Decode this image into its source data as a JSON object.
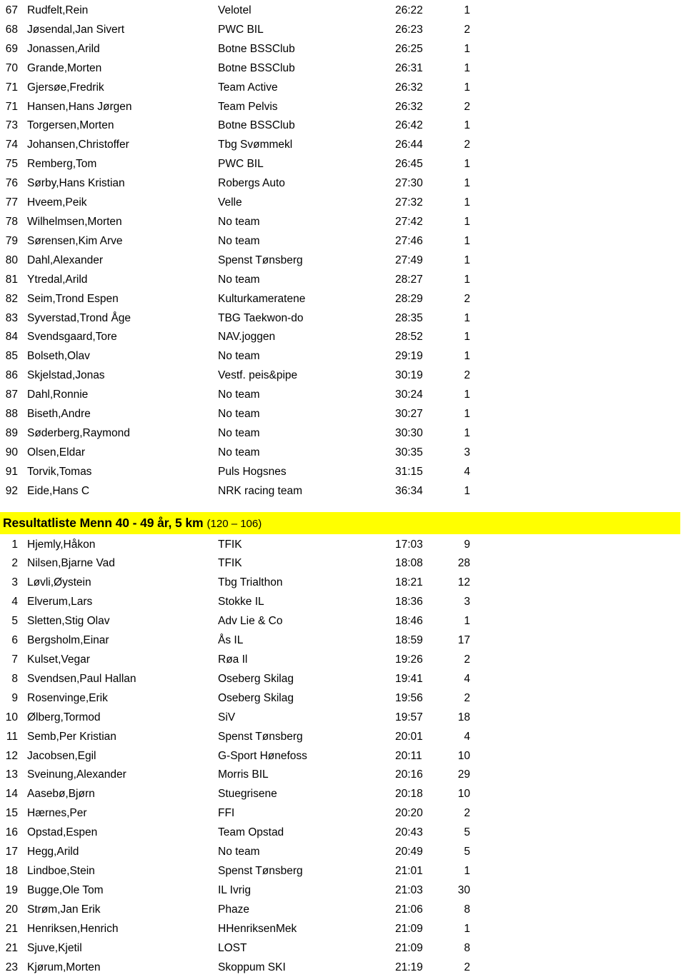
{
  "document": {
    "kind": "race-results-listing",
    "highlight_color": "#ffff00",
    "text_color": "#000000",
    "background_color": "#ffffff"
  },
  "columns": [
    "rank",
    "name",
    "team",
    "time",
    "points"
  ],
  "sections": [
    {
      "heading": null,
      "continued": true,
      "rows": [
        {
          "rank": "67",
          "name": "Rudfelt,Rein",
          "team": "Velotel",
          "time": "26:22",
          "points": "1"
        },
        {
          "rank": "68",
          "name": "Jøsendal,Jan Sivert",
          "team": "PWC BIL",
          "time": "26:23",
          "points": "2"
        },
        {
          "rank": "69",
          "name": "Jonassen,Arild",
          "team": "Botne BSSClub",
          "time": "26:25",
          "points": "1"
        },
        {
          "rank": "70",
          "name": "Grande,Morten",
          "team": "Botne BSSClub",
          "time": "26:31",
          "points": "1"
        },
        {
          "rank": "71",
          "name": "Gjersøe,Fredrik",
          "team": "Team Active",
          "time": "26:32",
          "points": "1"
        },
        {
          "rank": "71",
          "name": "Hansen,Hans Jørgen",
          "team": "Team Pelvis",
          "time": "26:32",
          "points": "2"
        },
        {
          "rank": "73",
          "name": "Torgersen,Morten",
          "team": "Botne BSSClub",
          "time": "26:42",
          "points": "1"
        },
        {
          "rank": "74",
          "name": "Johansen,Christoffer",
          "team": "Tbg Svømmekl",
          "time": "26:44",
          "points": "2"
        },
        {
          "rank": "75",
          "name": "Remberg,Tom",
          "team": "PWC BIL",
          "time": "26:45",
          "points": "1"
        },
        {
          "rank": "76",
          "name": "Sørby,Hans Kristian",
          "team": "Robergs Auto",
          "time": "27:30",
          "points": "1"
        },
        {
          "rank": "77",
          "name": "Hveem,Peik",
          "team": "Velle",
          "time": "27:32",
          "points": "1"
        },
        {
          "rank": "78",
          "name": "Wilhelmsen,Morten",
          "team": "No team",
          "time": "27:42",
          "points": "1"
        },
        {
          "rank": "79",
          "name": "Sørensen,Kim Arve",
          "team": "No team",
          "time": "27:46",
          "points": "1"
        },
        {
          "rank": "80",
          "name": "Dahl,Alexander",
          "team": "Spenst Tønsberg",
          "time": "27:49",
          "points": "1"
        },
        {
          "rank": "81",
          "name": "Ytredal,Arild",
          "team": "No team",
          "time": "28:27",
          "points": "1"
        },
        {
          "rank": "82",
          "name": "Seim,Trond Espen",
          "team": "Kulturkameratene",
          "time": "28:29",
          "points": "2"
        },
        {
          "rank": "83",
          "name": "Syverstad,Trond Åge",
          "team": "TBG Taekwon-do",
          "time": "28:35",
          "points": "1"
        },
        {
          "rank": "84",
          "name": "Svendsgaard,Tore",
          "team": "NAV.joggen",
          "time": "28:52",
          "points": "1"
        },
        {
          "rank": "85",
          "name": "Bolseth,Olav",
          "team": "No team",
          "time": "29:19",
          "points": "1"
        },
        {
          "rank": "86",
          "name": "Skjelstad,Jonas",
          "team": "Vestf.  peis&pipe",
          "time": "30:19",
          "points": "2"
        },
        {
          "rank": "87",
          "name": "Dahl,Ronnie",
          "team": "No team",
          "time": "30:24",
          "points": "1"
        },
        {
          "rank": "88",
          "name": "Biseth,Andre",
          "team": "No team",
          "time": "30:27",
          "points": "1"
        },
        {
          "rank": "89",
          "name": "Søderberg,Raymond",
          "team": "No team",
          "time": "30:30",
          "points": "1"
        },
        {
          "rank": "90",
          "name": "Olsen,Eldar",
          "team": "No team",
          "time": "30:35",
          "points": "3"
        },
        {
          "rank": "91",
          "name": "Torvik,Tomas",
          "team": "Puls Hogsnes",
          "time": "31:15",
          "points": "4"
        },
        {
          "rank": "92",
          "name": "Eide,Hans C",
          "team": "NRK racing team",
          "time": "36:34",
          "points": "1"
        }
      ]
    },
    {
      "heading": {
        "title": "Resultatliste Menn 40 - 49 år, 5 km",
        "count": "(120 – 106)"
      },
      "continued": false,
      "rows": [
        {
          "rank": "1",
          "name": "Hjemly,Håkon",
          "team": "TFIK",
          "time": "17:03",
          "points": "9"
        },
        {
          "rank": "2",
          "name": "Nilsen,Bjarne Vad",
          "team": "TFIK",
          "time": "18:08",
          "points": "28"
        },
        {
          "rank": "3",
          "name": "Løvli,Øystein",
          "team": "Tbg Trialthon",
          "time": "18:21",
          "points": "12"
        },
        {
          "rank": "4",
          "name": "Elverum,Lars",
          "team": "Stokke IL",
          "time": "18:36",
          "points": "3"
        },
        {
          "rank": "5",
          "name": "Sletten,Stig Olav",
          "team": "Adv Lie & Co",
          "time": "18:46",
          "points": "1"
        },
        {
          "rank": "6",
          "name": "Bergsholm,Einar",
          "team": "Ås IL",
          "time": "18:59",
          "points": "17"
        },
        {
          "rank": "7",
          "name": "Kulset,Vegar",
          "team": "Røa Il",
          "time": "19:26",
          "points": "2"
        },
        {
          "rank": "8",
          "name": "Svendsen,Paul Hallan",
          "team": "Oseberg Skilag",
          "time": "19:41",
          "points": "4"
        },
        {
          "rank": "9",
          "name": "Rosenvinge,Erik",
          "team": "Oseberg Skilag",
          "time": "19:56",
          "points": "2"
        },
        {
          "rank": "10",
          "name": "Ølberg,Tormod",
          "team": "SiV",
          "time": "19:57",
          "points": "18"
        },
        {
          "rank": "11",
          "name": "Semb,Per Kristian",
          "team": "Spenst Tønsberg",
          "time": "20:01",
          "points": "4"
        },
        {
          "rank": "12",
          "name": "Jacobsen,Egil",
          "team": "G-Sport Hønefoss",
          "time": "20:11",
          "points": "10"
        },
        {
          "rank": "13",
          "name": "Sveinung,Alexander",
          "team": "Morris BIL",
          "time": "20:16",
          "points": "29"
        },
        {
          "rank": "14",
          "name": "Aasebø,Bjørn",
          "team": "Stuegrisene",
          "time": "20:18",
          "points": "10"
        },
        {
          "rank": "15",
          "name": "Hærnes,Per",
          "team": "FFI",
          "time": "20:20",
          "points": "2"
        },
        {
          "rank": "16",
          "name": "Opstad,Espen",
          "team": "Team Opstad",
          "time": "20:43",
          "points": "5"
        },
        {
          "rank": "17",
          "name": "Hegg,Arild",
          "team": "No team",
          "time": "20:49",
          "points": "5"
        },
        {
          "rank": "18",
          "name": "Lindboe,Stein",
          "team": "Spenst Tønsberg",
          "time": "21:01",
          "points": "1"
        },
        {
          "rank": "19",
          "name": "Bugge,Ole Tom",
          "team": "IL Ivrig",
          "time": "21:03",
          "points": "30"
        },
        {
          "rank": "20",
          "name": "Strøm,Jan Erik",
          "team": "Phaze",
          "time": "21:06",
          "points": "8"
        },
        {
          "rank": "21",
          "name": "Henriksen,Henrich",
          "team": "HHenriksenMek",
          "time": "21:09",
          "points": "1"
        },
        {
          "rank": "21",
          "name": "Sjuve,Kjetil",
          "team": "LOST",
          "time": "21:09",
          "points": "8"
        },
        {
          "rank": "23",
          "name": "Kjørum,Morten",
          "team": "Skoppum SKI",
          "time": "21:19",
          "points": "2"
        }
      ]
    }
  ]
}
